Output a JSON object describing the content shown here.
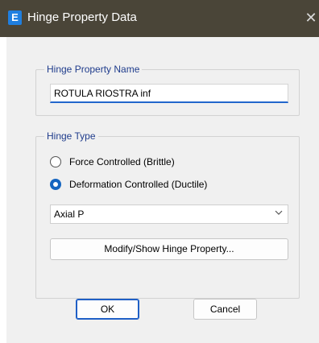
{
  "window": {
    "app_icon_letter": "E",
    "title": "Hinge Property Data",
    "close_symbol": "✕"
  },
  "hinge_property_name": {
    "group_label": "Hinge Property Name",
    "value": "ROTULA RIOSTRA inf"
  },
  "hinge_type": {
    "group_label": "Hinge Type",
    "options": [
      {
        "label": "Force Controlled  (Brittle)",
        "selected": false
      },
      {
        "label": "Deformation Controlled  (Ductile)",
        "selected": true
      }
    ],
    "dof_selected": "Axial P",
    "modify_button": "Modify/Show Hinge Property..."
  },
  "buttons": {
    "ok": "OK",
    "cancel": "Cancel"
  },
  "colors": {
    "titlebar": "#4a4538",
    "accent": "#1565c0",
    "group_label": "#1f3c8c",
    "dialog_bg": "#f0f0f0"
  },
  "icons": {
    "app": "etabs-e-icon",
    "close": "close-icon",
    "dropdown": "chevron-down-icon"
  }
}
